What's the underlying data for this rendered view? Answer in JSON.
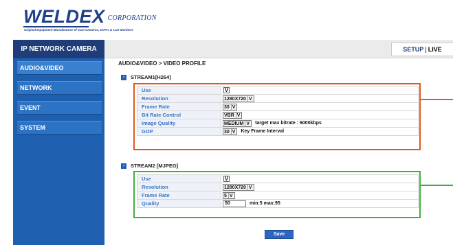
{
  "brand": {
    "name": "WELDEX",
    "suffix": "CORPORATION",
    "tagline": "Original Equipment Manufacturer of CCD Cameras, DVR's & LCD Monitors",
    "color": "#1e3f8a"
  },
  "header": {
    "product": "IP NETWORK CAMERA",
    "setup": "SETUP",
    "separator": "|",
    "live": "LIVE"
  },
  "sidebar": {
    "items": [
      {
        "label": "AUDIO&VIDEO"
      },
      {
        "label": "NETWORK"
      },
      {
        "label": "EVENT"
      },
      {
        "label": "SYSTEM"
      }
    ]
  },
  "main": {
    "breadcrumb": "AUDIO&VIDEO > VIDEO PROFILE",
    "stream1": {
      "title": "STREAM1[H264]",
      "use_label": "Use",
      "use_checked": "V",
      "resolution_label": "Resolution",
      "resolution_value": "1280X720",
      "framerate_label": "Frame Rate",
      "framerate_value": "30",
      "bitrate_label": "Bit Rate Control",
      "bitrate_value": "VBR",
      "quality_label": "Image Quality",
      "quality_value": "MEDIUM",
      "quality_note": "target max bitrate : 6000kbps",
      "gop_label": "GOP",
      "gop_value": "30",
      "gop_note": "Key Frame Interval"
    },
    "stream2": {
      "title": "STREAM2 [MJPEG]",
      "use_label": "Use",
      "use_checked": "V",
      "resolution_label": "Resolution",
      "resolution_value": "1280X720",
      "framerate_label": "Frame Rate",
      "framerate_value": "5",
      "quality_label": "Quality",
      "quality_value": "50",
      "quality_note": "min:5 max:95"
    },
    "caret": "V",
    "arrow": "›",
    "save_label": "Save"
  },
  "colors": {
    "stream1_frame": "#e3561c",
    "stream2_frame": "#3fb03a",
    "nav": "#1f3e79",
    "sidebar": "#1f5fb0"
  }
}
